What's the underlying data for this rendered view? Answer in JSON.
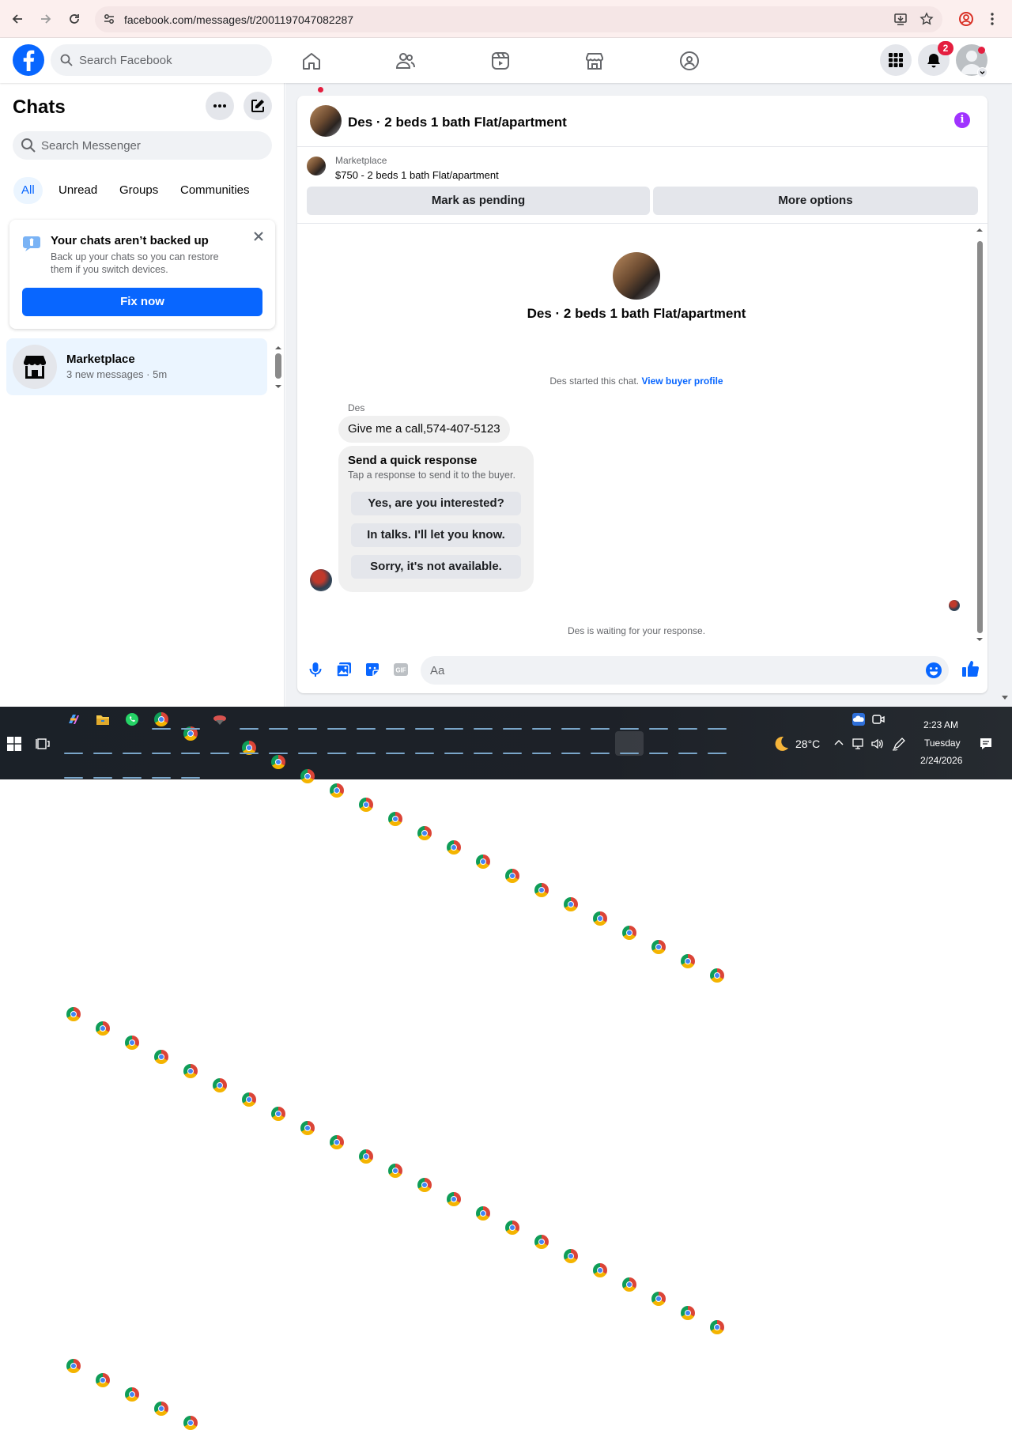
{
  "browser": {
    "url": "facebook.com/messages/t/2001197047082287"
  },
  "header": {
    "search_placeholder": "Search Facebook",
    "notification_count": "2"
  },
  "sidebar": {
    "title": "Chats",
    "search_placeholder": "Search Messenger",
    "filters": [
      "All",
      "Unread",
      "Groups",
      "Communities"
    ],
    "backup": {
      "title": "Your chats aren’t backed up",
      "description": "Back up your chats so you can restore them if you switch devices.",
      "button": "Fix now"
    },
    "conversations": [
      {
        "name": "Marketplace",
        "preview": "3 new messages · 5m"
      }
    ]
  },
  "chat": {
    "title": "Des · 2 beds 1 bath Flat/apartment",
    "marketplace_label": "Marketplace",
    "listing": "$750 - 2 beds 1 bath Flat/apartment",
    "mark_pending": "Mark as pending",
    "more_options": "More options",
    "started_text": "Des started this chat.",
    "view_buyer": "View buyer profile",
    "sender": "Des",
    "message": "Give me a call,574-407-5123",
    "quick_title": "Send a quick response",
    "quick_sub": "Tap a response to send it to the buyer.",
    "quick_responses": [
      "Yes, are you interested?",
      "In talks. I'll let you know.",
      "Sorry, it's not available."
    ],
    "waiting": "Des is waiting for your response.",
    "composer_placeholder": "Aa"
  },
  "taskbar": {
    "weather": "28°C",
    "time": "2:23 AM",
    "day": "Tuesday",
    "date": "2/24/2026"
  },
  "colors": {
    "fb_blue": "#0866ff",
    "info_purple": "#a033ff",
    "badge_red": "#e41e3f"
  }
}
